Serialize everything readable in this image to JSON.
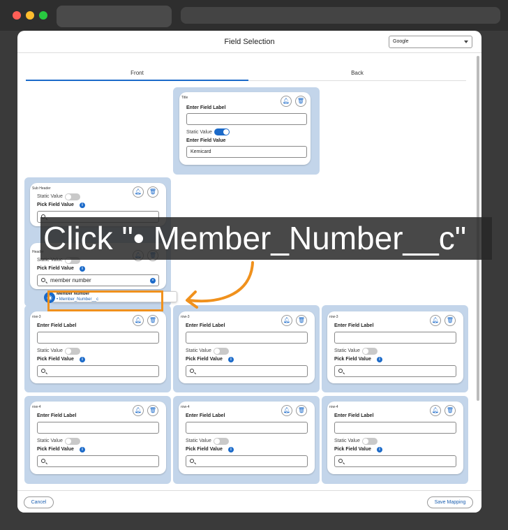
{
  "window": {
    "title": "Field Selection",
    "provider_select": "Google"
  },
  "tabs": [
    {
      "label": "Front",
      "active": true
    },
    {
      "label": "Back",
      "active": false
    }
  ],
  "labels": {
    "enter_field_label": "Enter Field Label",
    "enter_field_value": "Enter Field Value",
    "static_value": "Static Value",
    "pick_field_value": "Pick Field Value"
  },
  "title_card": {
    "tag": "Title",
    "field_value": "Kemicard",
    "static_on": true
  },
  "sub_header_card": {
    "tag": "Sub Header"
  },
  "header_card": {
    "tag": "Header",
    "search_value": "member number"
  },
  "dropdown": {
    "title": "Member Number",
    "option": "• Member_Number__c"
  },
  "rows": [
    {
      "tag": "row-3"
    },
    {
      "tag": "row-4"
    }
  ],
  "footer": {
    "cancel": "Cancel",
    "save": "Save Mapping"
  },
  "instruction": {
    "text": "Click \"• Member_Number__c\""
  },
  "colors": {
    "accent": "#1b6ac9",
    "highlight": "#f0911d",
    "group_bg": "#c3d5ea"
  }
}
